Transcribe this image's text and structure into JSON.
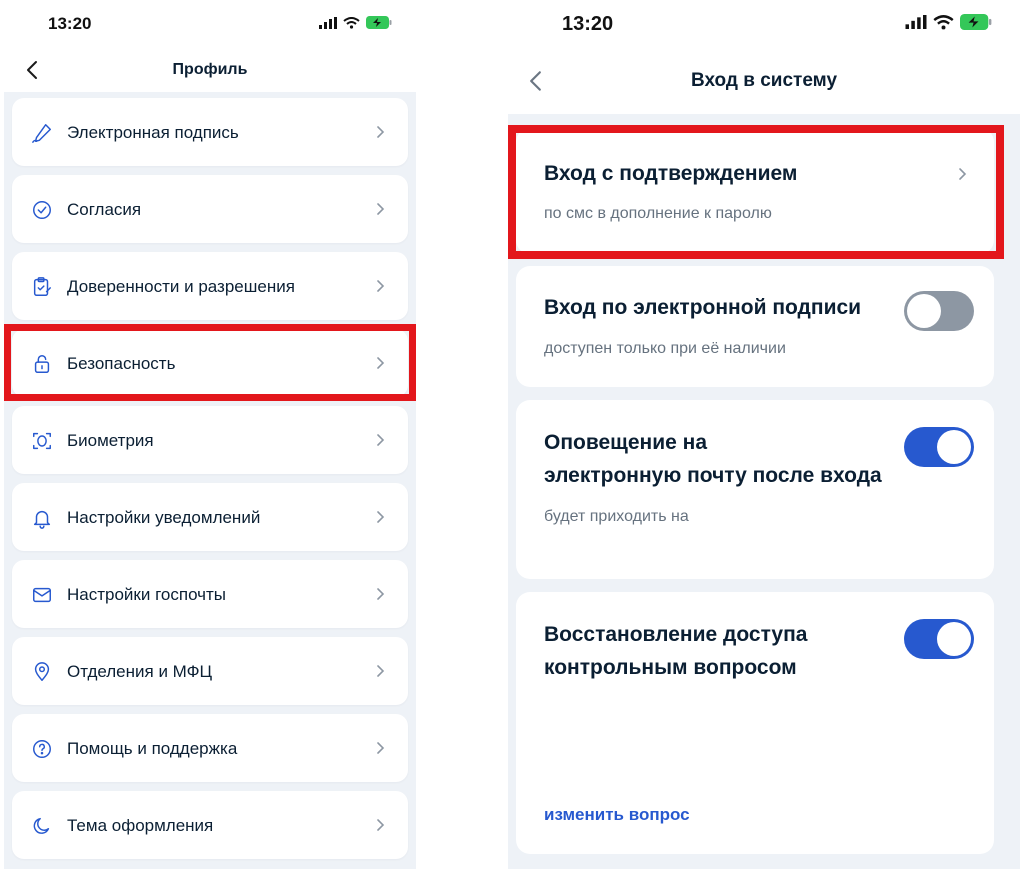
{
  "left": {
    "status": {
      "time": "13:20"
    },
    "header": {
      "title": "Профиль"
    },
    "menu": [
      {
        "label": "Электронная подпись",
        "icon": "pen-icon"
      },
      {
        "label": "Согласия",
        "icon": "check-circle-icon"
      },
      {
        "label": "Доверенности и разрешения",
        "icon": "clipboard-check-icon"
      },
      {
        "label": "Безопасность",
        "icon": "lock-open-icon"
      },
      {
        "label": "Биометрия",
        "icon": "face-scan-icon"
      },
      {
        "label": "Настройки уведомлений",
        "icon": "bell-icon"
      },
      {
        "label": "Настройки госпочты",
        "icon": "mail-icon"
      },
      {
        "label": "Отделения и МФЦ",
        "icon": "location-pin-icon"
      },
      {
        "label": "Помощь и поддержка",
        "icon": "help-circle-icon"
      },
      {
        "label": "Тема оформления",
        "icon": "moon-icon"
      }
    ]
  },
  "right": {
    "status": {
      "time": "13:20"
    },
    "header": {
      "title": "Вход в систему"
    },
    "confirm_login": {
      "title": "Вход с подтверждением",
      "subtitle": "по смс в дополнение к паролю"
    },
    "esign_login": {
      "title": "Вход по электронной подписи",
      "subtitle": "доступен только при её наличии",
      "enabled": false
    },
    "email_notify": {
      "title_line1": "Оповещение на",
      "title_line2": "электронную почту после входа",
      "subtitle": "будет приходить на",
      "enabled": true
    },
    "recovery": {
      "title_line1": "Восстановление доступа",
      "title_line2": "контрольным вопросом",
      "link": "изменить вопрос",
      "enabled": true
    }
  },
  "colors": {
    "accent": "#2759cf",
    "highlight": "#e3171c",
    "background": "#eef2f7",
    "toggle_off": "#8d97a3"
  }
}
